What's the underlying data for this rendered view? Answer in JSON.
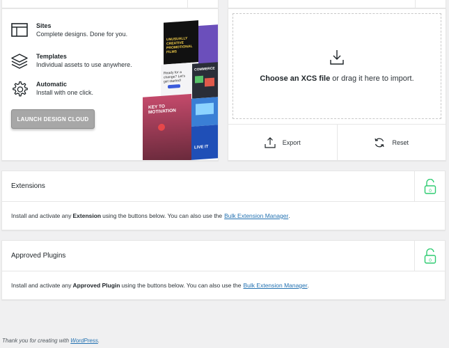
{
  "design_cloud": {
    "features": [
      {
        "title": "Sites",
        "desc": "Complete designs. Done for you.",
        "icon": "browser-window-icon"
      },
      {
        "title": "Templates",
        "desc": "Individual assets to use anywhere.",
        "icon": "layers-icon"
      },
      {
        "title": "Automatic",
        "desc": "Install with one click.",
        "icon": "gear-icon"
      }
    ],
    "launch_label": "LAUNCH DESIGN CLOUD",
    "collage": {
      "tile1": "UNUSUALLY CREATIVE PROMOTIONAL FILMS",
      "tile2": "Ready for a change? Let's get started!",
      "tile3": "COMMERCE",
      "tile4": "KEY TO MOTIVATION",
      "tile5": "LIVE IT"
    }
  },
  "import": {
    "drop_strong": "Choose an XCS file",
    "drop_rest": " or drag it here to import.",
    "export_label": "Export",
    "reset_label": "Reset"
  },
  "extensions": {
    "title": "Extensions",
    "body_pre": "Install and activate any ",
    "body_strong": "Extension",
    "body_post": " using the buttons below. You can also use the",
    "link": "Bulk Extension Manager",
    "end": "."
  },
  "plugins": {
    "title": "Approved Plugins",
    "body_pre": "Install and activate any ",
    "body_strong": "Approved Plugin",
    "body_post": " using the buttons below. You can also use the",
    "link": "Bulk Extension Manager",
    "end": "."
  },
  "footer": {
    "text": "Thank you for creating with ",
    "link": "WordPress",
    "end": "."
  },
  "colors": {
    "accent_green": "#2ecc71",
    "link_blue": "#2271b1",
    "button_gray": "#a7a7a7"
  }
}
